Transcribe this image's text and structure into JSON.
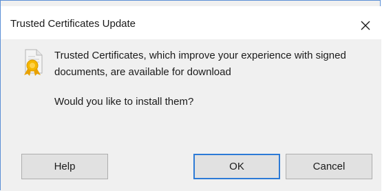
{
  "window": {
    "title": "Trusted Certificates Update",
    "close_glyph": "✕"
  },
  "icon": "certificate-icon",
  "message": {
    "body": "Trusted Certificates, which improve your experience with signed documents, are available for download",
    "question": "Would you like to install them?"
  },
  "buttons": {
    "help": "Help",
    "ok": "OK",
    "cancel": "Cancel"
  },
  "colors": {
    "accent": "#2c7ad6",
    "window_border": "#5b8fd6",
    "content_bg": "#f0f0f0"
  }
}
